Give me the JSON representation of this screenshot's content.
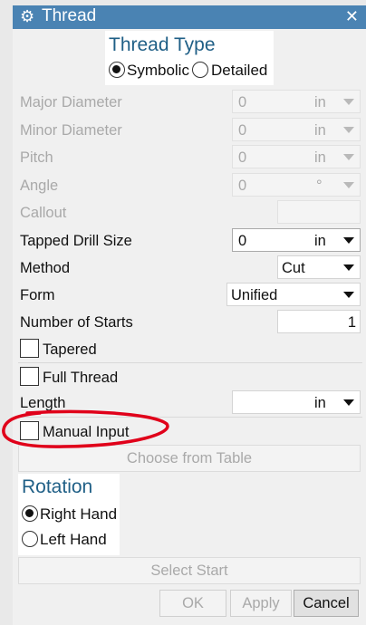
{
  "window": {
    "title": "Thread",
    "close_symbol": "✕",
    "icon": "gear-icon"
  },
  "thread_type": {
    "title": "Thread Type",
    "options": [
      "Symbolic",
      "Detailed"
    ],
    "selected": "Symbolic"
  },
  "fields": {
    "major_diameter": {
      "label": "Major Diameter",
      "value": "0",
      "unit": "in"
    },
    "minor_diameter": {
      "label": "Minor Diameter",
      "value": "0",
      "unit": "in"
    },
    "pitch": {
      "label": "Pitch",
      "value": "0",
      "unit": "in"
    },
    "angle": {
      "label": "Angle",
      "value": "0",
      "unit": "°"
    },
    "callout": {
      "label": "Callout",
      "value": ""
    },
    "tapped_drill_size": {
      "label": "Tapped Drill Size",
      "value": "0",
      "unit": "in"
    },
    "method": {
      "label": "Method",
      "value": "Cut"
    },
    "form": {
      "label": "Form",
      "value": "Unified"
    },
    "number_of_starts": {
      "label": "Number of Starts",
      "value": "1"
    },
    "length": {
      "label": "Length",
      "value": "",
      "unit": "in"
    }
  },
  "checkboxes": {
    "tapered": {
      "label": "Tapered",
      "checked": false
    },
    "full_thread": {
      "label": "Full Thread",
      "checked": false
    },
    "manual_input": {
      "label": "Manual Input",
      "checked": false
    }
  },
  "choose_from_table": "Choose from Table",
  "rotation": {
    "title": "Rotation",
    "options": [
      "Right Hand",
      "Left Hand"
    ],
    "selected": "Right Hand"
  },
  "select_start": "Select Start",
  "footer": {
    "ok": "OK",
    "apply": "Apply",
    "cancel": "Cancel"
  },
  "colors": {
    "titlebar": "#4a83b3",
    "section_title": "#1f5f86",
    "annotation": "#e0001a"
  }
}
